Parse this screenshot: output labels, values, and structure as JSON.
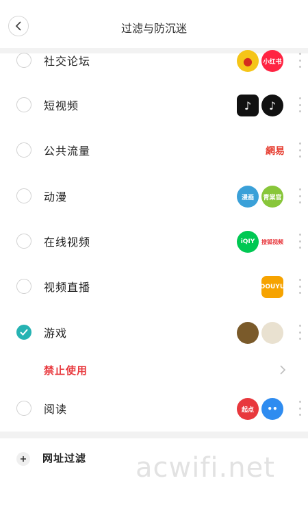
{
  "header": {
    "title": "过滤与防沉迷"
  },
  "categories": [
    {
      "label": "社交论坛",
      "apps": [
        {
          "icon": "weibo-icon",
          "color": "#f5c518",
          "text": ""
        },
        {
          "icon": "xiaohongshu-icon",
          "color": "#ff2442",
          "text": "小红书"
        }
      ]
    },
    {
      "label": "短视频",
      "apps": [
        {
          "icon": "douyin-small-icon",
          "color": "#111111",
          "text": ""
        },
        {
          "icon": "douyin-icon",
          "color": "#111111",
          "text": ""
        }
      ]
    },
    {
      "label": "公共流量",
      "apps": [
        {
          "icon": "netease-logo",
          "color": "#e63b2e",
          "text": "網易"
        }
      ]
    },
    {
      "label": "动漫",
      "apps": [
        {
          "icon": "manhua-icon",
          "color": "#3aa0d8",
          "text": "漫画"
        },
        {
          "icon": "qingshiguang-icon",
          "color": "#88c63a",
          "text": "青棠官"
        }
      ]
    },
    {
      "label": "在线视频",
      "apps": [
        {
          "icon": "iqiyi-icon",
          "color": "#00c853",
          "text": "iQIY"
        },
        {
          "icon": "sohu-video-icon",
          "color": "#e8383d",
          "text": "搜狐视频"
        }
      ]
    },
    {
      "label": "视频直播",
      "apps": [
        {
          "icon": "douyu-icon",
          "color": "#f6a300",
          "text": "DOUYU"
        }
      ]
    },
    {
      "label": "游戏",
      "apps": [
        {
          "icon": "game-a-icon",
          "color": "#7a5a2a",
          "text": ""
        },
        {
          "icon": "game-b-icon",
          "color": "#e9e1d0",
          "text": ""
        }
      ],
      "checked": true
    },
    {
      "label": "阅读",
      "apps": [
        {
          "icon": "qidian-icon",
          "color": "#e8383d",
          "text": "起点"
        },
        {
          "icon": "chat-bubble-icon",
          "color": "#2f8cf0",
          "text": ""
        }
      ]
    }
  ],
  "banned": {
    "label": "禁止使用"
  },
  "url_filter": {
    "label": "网址过滤"
  },
  "watermark": "acwifi.net"
}
